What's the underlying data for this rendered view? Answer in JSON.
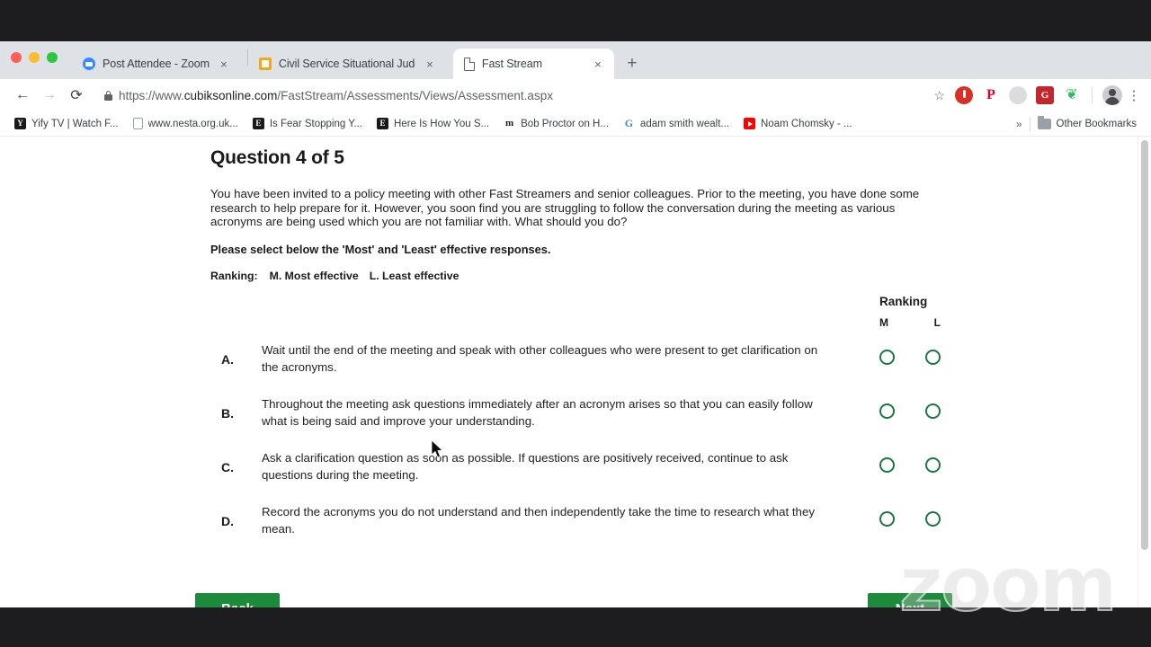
{
  "browser": {
    "traffic_lights": [
      "close",
      "minimize",
      "zoom"
    ],
    "tabs": [
      {
        "title": "Post Attendee - Zoom",
        "favicon": "zoom-logo-icon",
        "active": false
      },
      {
        "title": "Civil Service Situational Judge",
        "favicon": "orange-square-icon",
        "active": false
      },
      {
        "title": "Fast Stream",
        "favicon": "document-icon",
        "active": true
      }
    ],
    "new_tab_label": "+",
    "tab_close_label": "×",
    "toolbar": {
      "back_icon": "←",
      "forward_icon": "→",
      "reload_icon": "⟳",
      "lock_icon": "lock-icon",
      "url_secure": "https://www.",
      "url_domain": "cubiksonline.com",
      "url_path": "/FastStream/Assessments/Views/Assessment.aspx",
      "url_full": "https://www.cubiksonline.com/FastStream/Assessments/Views/Assessment.aspx",
      "star_icon": "☆",
      "extensions": [
        {
          "name": "red-circle-extension",
          "glyph": ""
        },
        {
          "name": "pinterest-extension",
          "glyph": "P"
        },
        {
          "name": "grey-circle-extension",
          "glyph": ""
        },
        {
          "name": "red-square-extension",
          "glyph": "G"
        },
        {
          "name": "evernote-extension",
          "glyph": "❦"
        }
      ],
      "avatar_name": "profile-avatar",
      "menu_icon": "⋮"
    },
    "bookmarks": [
      {
        "label": "Yify TV | Watch F...",
        "icon": "yify-icon"
      },
      {
        "label": "www.nesta.org.uk...",
        "icon": "page-icon"
      },
      {
        "label": "Is Fear Stopping Y...",
        "icon": "evernote-e-icon"
      },
      {
        "label": "Here Is How You S...",
        "icon": "evernote-e-icon"
      },
      {
        "label": "Bob Proctor on H...",
        "icon": "medium-m-icon"
      },
      {
        "label": "adam smith wealt...",
        "icon": "google-g-icon"
      },
      {
        "label": "Noam Chomsky - ...",
        "icon": "youtube-icon"
      }
    ],
    "bookmarks_overflow": "»",
    "other_bookmarks_label": "Other Bookmarks"
  },
  "page": {
    "title": "Question 4 of 5",
    "scenario": "You have been invited to a policy meeting with other Fast Streamers and senior colleagues. Prior to the meeting, you have done some research to help prepare for it. However, you soon find you are struggling to follow the conversation during the meeting as various acronyms are being used which you are not familiar with. What should you do?",
    "instruction": "Please select below the 'Most' and 'Least' effective responses.",
    "ranking_key_label": "Ranking:",
    "ranking_key_most": "M. Most effective",
    "ranking_key_least": "L. Least effective",
    "ranking_header": "Ranking",
    "column_most": "M",
    "column_least": "L",
    "options": [
      {
        "letter": "A.",
        "text": "Wait until the end of the meeting and speak with other colleagues who were present to get clarification on the acronyms.",
        "most_selected": false,
        "least_selected": false
      },
      {
        "letter": "B.",
        "text": "Throughout the meeting ask questions immediately after an acronym arises so that you can easily follow what is being said and improve your understanding.",
        "most_selected": false,
        "least_selected": false
      },
      {
        "letter": "C.",
        "text": "Ask a clarification question as soon as possible. If questions are positively received, continue to ask questions during the meeting.",
        "most_selected": false,
        "least_selected": false
      },
      {
        "letter": "D.",
        "text": "Record the acronyms you do not understand and then independently take the time to research what they mean.",
        "most_selected": false,
        "least_selected": false
      }
    ],
    "back_button": "Back",
    "next_button": "Next",
    "accent_green": "#1e8a3c",
    "radio_green": "#1a7a3c"
  },
  "overlay": {
    "watermark": "zoom"
  }
}
